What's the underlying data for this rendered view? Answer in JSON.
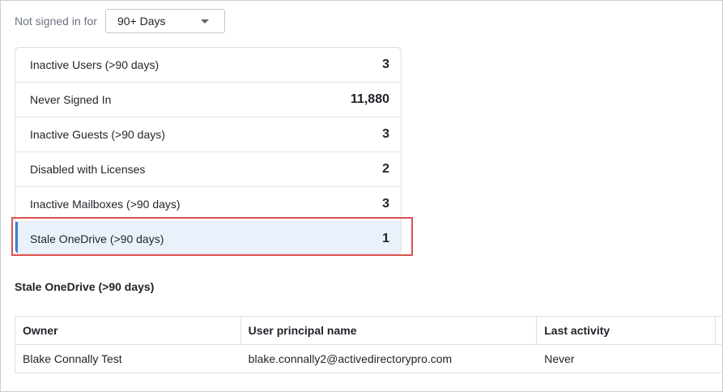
{
  "filter": {
    "label": "Not signed in for",
    "selected": "90+ Days"
  },
  "summary": [
    {
      "label": "Inactive Users (>90 days)",
      "count": "3",
      "selected": false
    },
    {
      "label": "Never Signed In",
      "count": "11,880",
      "selected": false
    },
    {
      "label": "Inactive Guests (>90 days)",
      "count": "3",
      "selected": false
    },
    {
      "label": "Disabled with Licenses",
      "count": "2",
      "selected": false
    },
    {
      "label": "Inactive Mailboxes (>90 days)",
      "count": "3",
      "selected": false
    },
    {
      "label": "Stale OneDrive (>90 days)",
      "count": "1",
      "selected": true
    }
  ],
  "section": {
    "title": "Stale OneDrive (>90 days)"
  },
  "table": {
    "headers": [
      "Owner",
      "User principal name",
      "Last activity"
    ],
    "rows": [
      [
        "Blake Connally Test",
        "blake.connally2@activedirectorypro.com",
        "Never"
      ]
    ]
  },
  "colors": {
    "accent": "#3b7ddd",
    "selected_bg": "#eaf1fb",
    "highlight": "#d9534f"
  }
}
